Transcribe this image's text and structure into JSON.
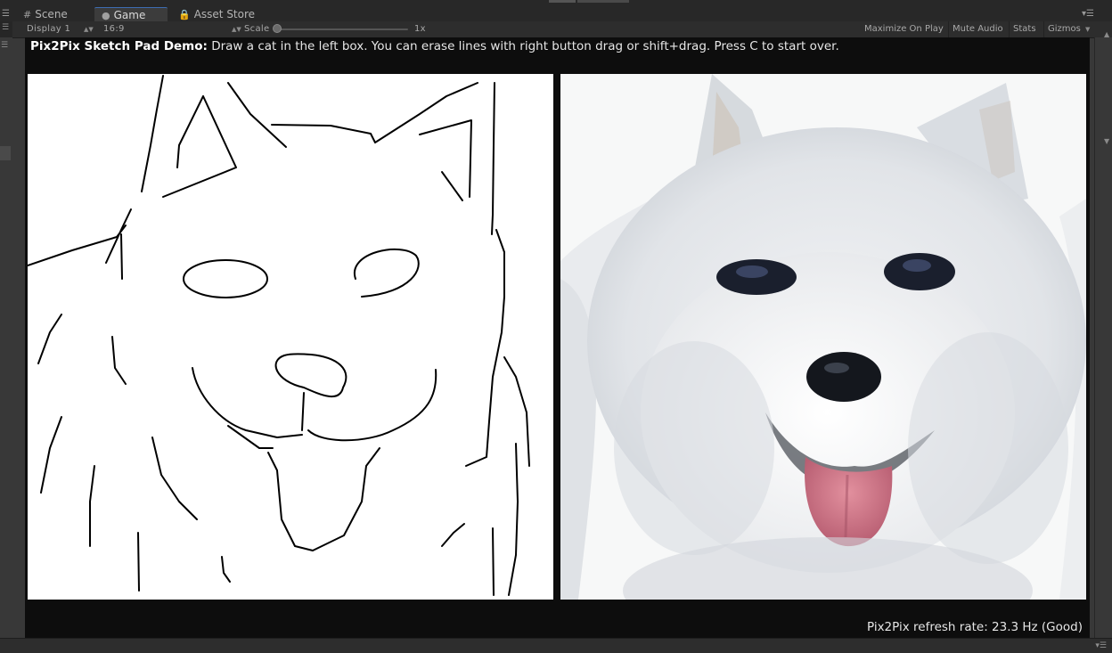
{
  "tabs": [
    {
      "icon": "grid-icon",
      "label": "Scene",
      "active": false
    },
    {
      "icon": "game-controller-icon",
      "label": "Game",
      "active": true
    },
    {
      "icon": "lock-icon",
      "label": "Asset Store",
      "active": false
    }
  ],
  "toolbar": {
    "display": "Display 1",
    "aspect": "16:9",
    "scale_label": "Scale",
    "scale_value": "1x",
    "maximize_on_play": "Maximize On Play",
    "mute_audio": "Mute Audio",
    "stats": "Stats",
    "gizmos": "Gizmos"
  },
  "game": {
    "title": "Pix2Pix Sketch Pad Demo:",
    "instructions": "Draw a cat in the left box. You can erase lines with right button drag or shift+drag. Press C to start over.",
    "refresh_rate": "Pix2Pix refresh rate: 23.3 Hz (Good)"
  },
  "colors": {
    "accent": "#3d6db3",
    "viewport_bg": "#0d0d0d",
    "editor_bg": "#383838"
  }
}
